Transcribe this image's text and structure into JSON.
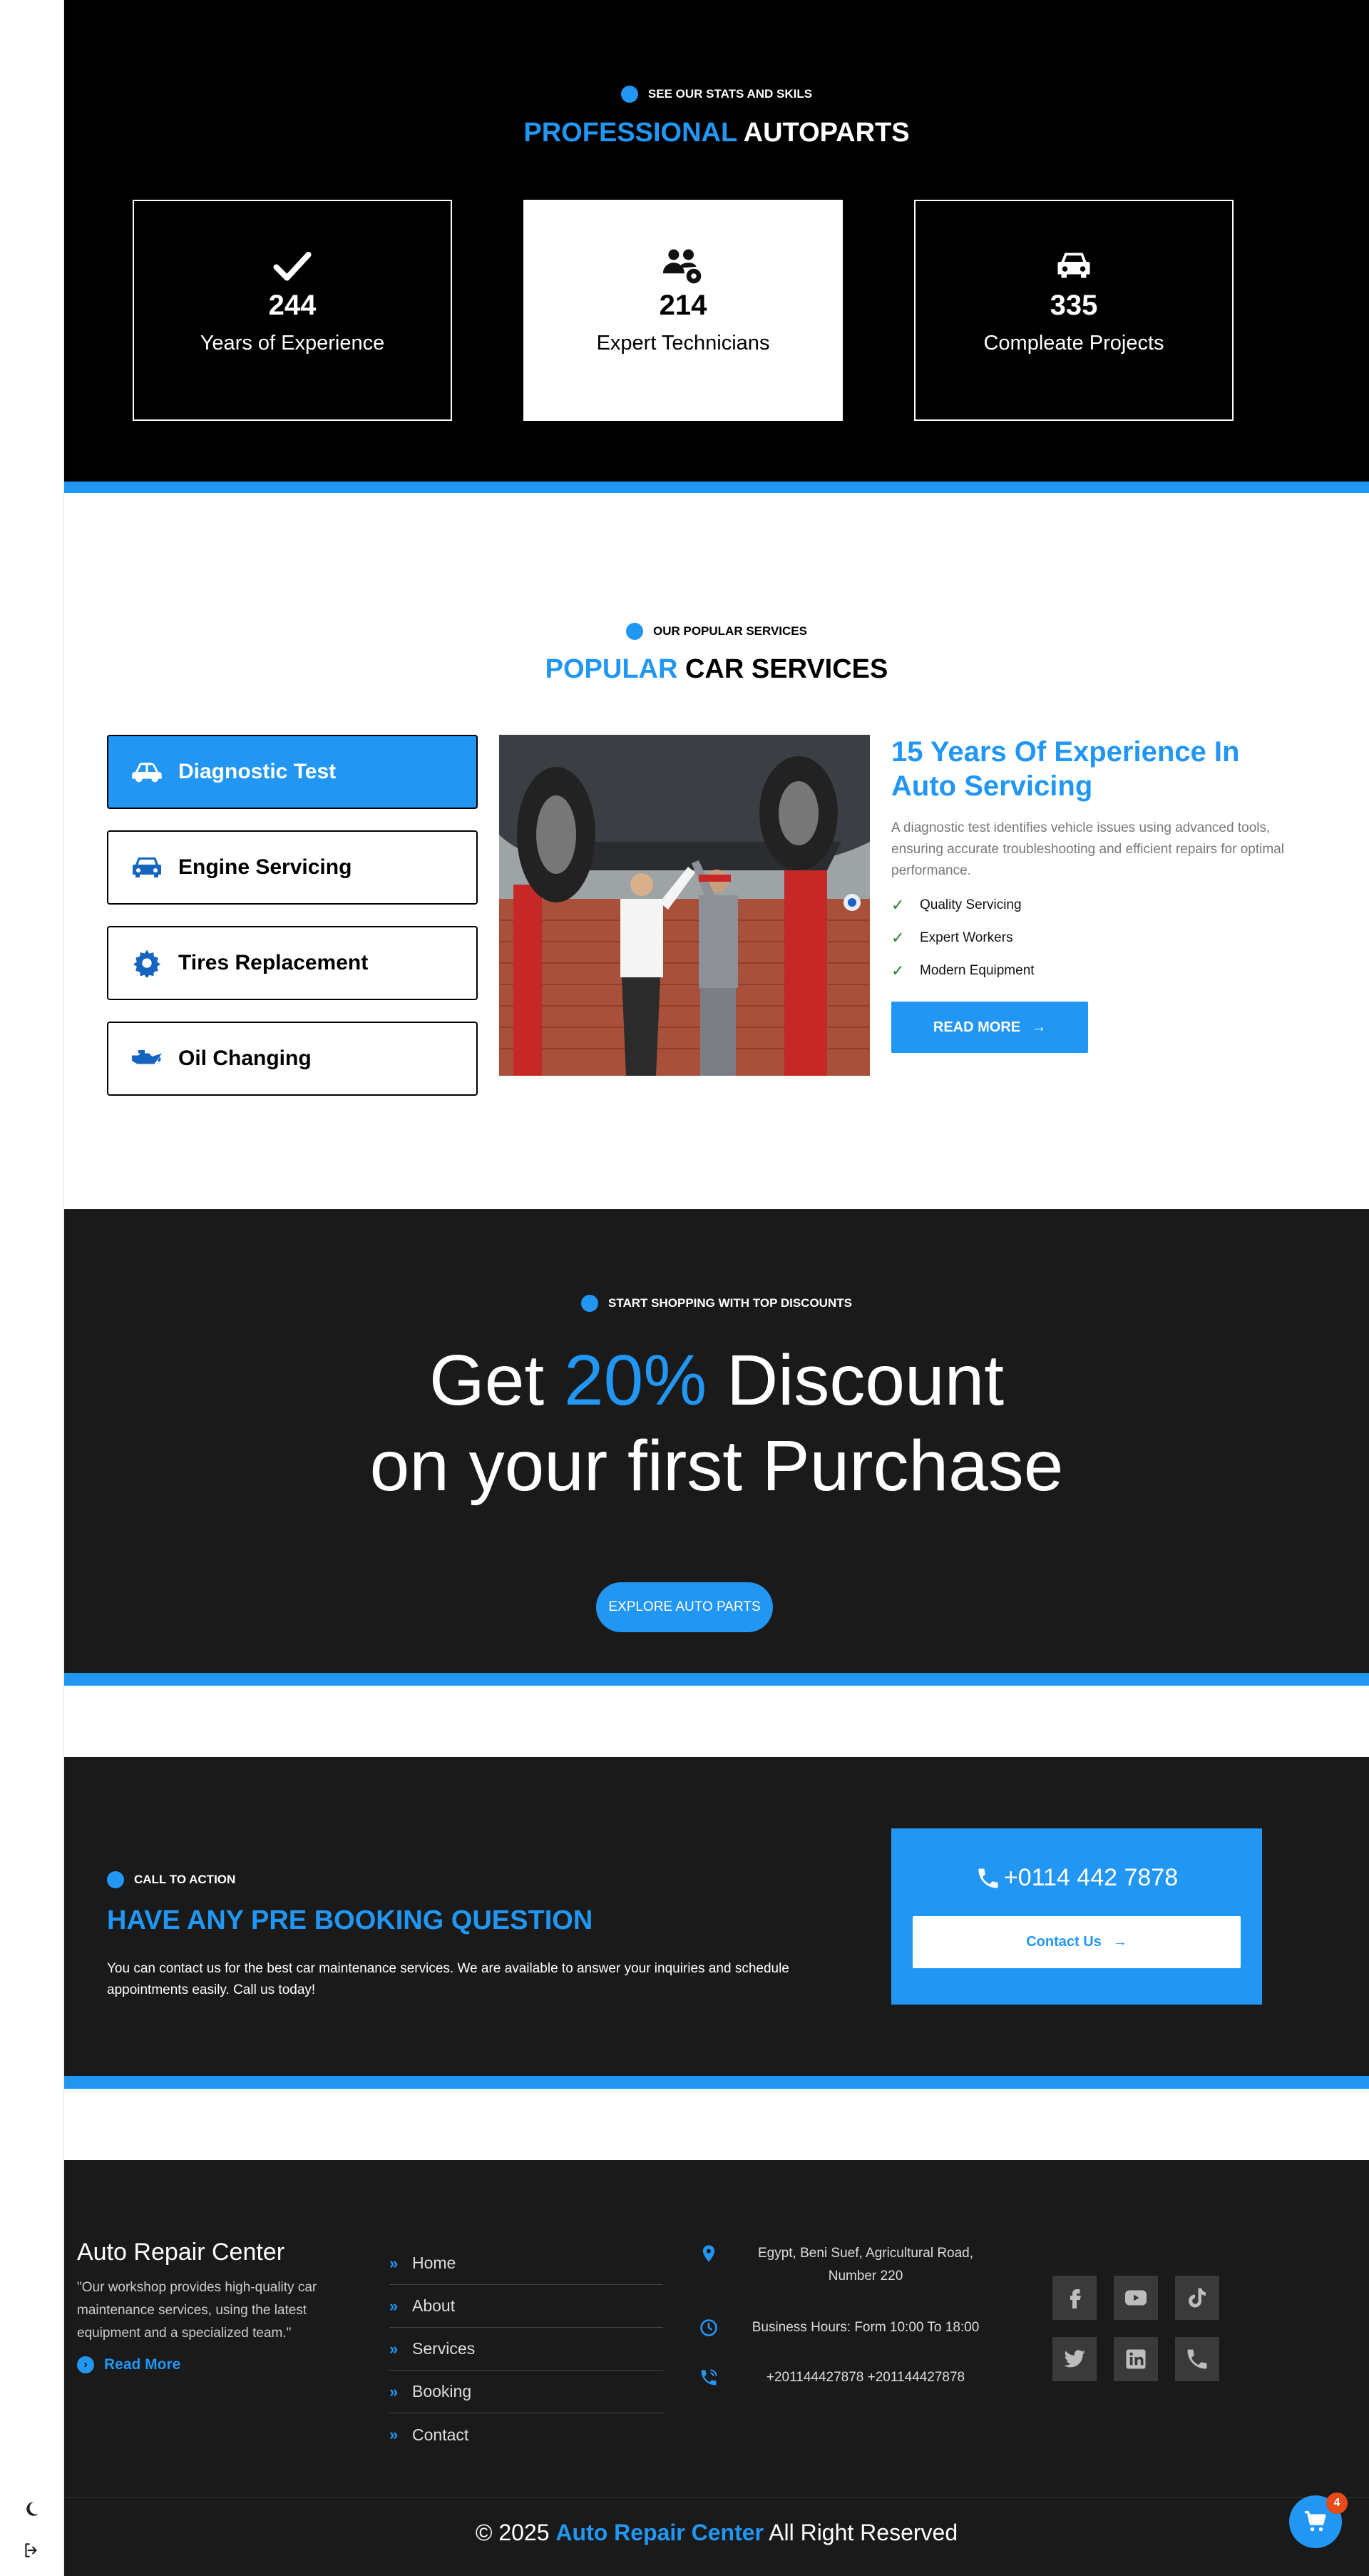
{
  "stats": {
    "eyebrow": "SEE OUR STATS AND SKILS",
    "title_accent": "PROFESSIONAL",
    "title_rest": "AUTOPARTS",
    "cards": [
      {
        "icon": "check-icon",
        "number": "244",
        "label": "Years of Experience"
      },
      {
        "icon": "technicians-icon",
        "number": "214",
        "label": "Expert Technicians"
      },
      {
        "icon": "car-icon",
        "number": "335",
        "label": "Compleate Projects"
      }
    ]
  },
  "services": {
    "eyebrow": "OUR POPULAR SERVICES",
    "title_accent": "POPULAR",
    "title_rest": "CAR SERVICES",
    "tabs": [
      {
        "label": "Diagnostic Test",
        "icon": "car-side-icon",
        "active": true
      },
      {
        "label": "Engine Servicing",
        "icon": "car-front-icon",
        "active": false
      },
      {
        "label": "Tires Replacement",
        "icon": "gear-icon",
        "active": false
      },
      {
        "label": "Oil Changing",
        "icon": "oil-can-icon",
        "active": false
      }
    ],
    "heading": "15 Years Of Experience In Auto Servicing",
    "description": "A diagnostic test identifies vehicle issues using advanced tools, ensuring accurate troubleshooting and efficient repairs for optimal performance.",
    "features": [
      "Quality Servicing",
      "Expert Workers",
      "Modern Equipment"
    ],
    "read_more": "READ MORE"
  },
  "discount": {
    "eyebrow": "START SHOPPING WITH TOP DISCOUNTS",
    "line1_pre": "Get",
    "line1_accent": "20%",
    "line1_post": "Discount",
    "line2": "on your first Purchase",
    "button": "EXPLORE AUTO PARTS"
  },
  "cta": {
    "eyebrow": "CALL TO ACTION",
    "title": "HAVE ANY PRE BOOKING QUESTION",
    "text": "You can contact us for the best car maintenance services. We are available to answer your inquiries and schedule appointments easily. Call us today!",
    "phone": "+0114 442 7878",
    "contact_button": "Contact Us"
  },
  "footer": {
    "brand": "Auto Repair Center",
    "quote": "\"Our workshop provides high-quality car maintenance services, using the latest equipment and a specialized team.\"",
    "read_more": "Read More",
    "links": [
      "Home",
      "About",
      "Services",
      "Booking",
      "Contact"
    ],
    "address": "Egypt, Beni Suef, Agricultural Road, Number 220",
    "hours": "Business Hours: Form 10:00 To 18:00",
    "phones": "+201144427878 +201144427878",
    "copyright_pre": "© 2025",
    "copyright_brand": "Auto Repair Center",
    "copyright_post": "All Right Reserved"
  },
  "cart": {
    "count": "4"
  },
  "colors": {
    "accent": "#2196f3",
    "dark": "#1a1a1b",
    "badge": "#e64a19"
  }
}
